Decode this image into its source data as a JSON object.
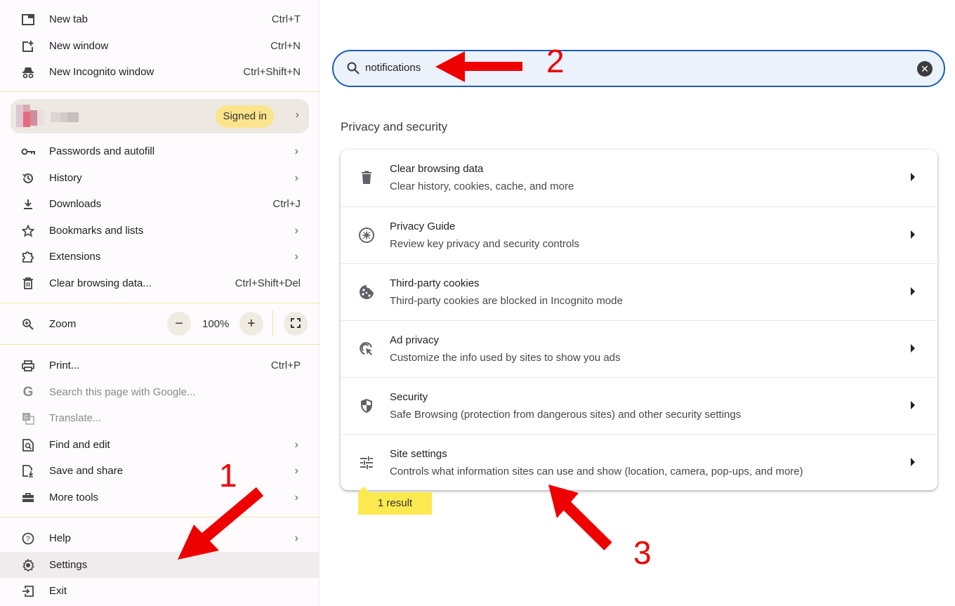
{
  "menu": {
    "items_top": [
      {
        "icon": "new-tab-icon",
        "label": "New tab",
        "shortcut": "Ctrl+T"
      },
      {
        "icon": "new-window-icon",
        "label": "New window",
        "shortcut": "Ctrl+N"
      },
      {
        "icon": "incognito-icon",
        "label": "New Incognito window",
        "shortcut": "Ctrl+Shift+N"
      }
    ],
    "profile": {
      "badge": "Signed in"
    },
    "items_mid": [
      {
        "icon": "key-icon",
        "label": "Passwords and autofill",
        "shortcut": "",
        "submenu": true
      },
      {
        "icon": "history-icon",
        "label": "History",
        "shortcut": "",
        "submenu": true
      },
      {
        "icon": "download-icon",
        "label": "Downloads",
        "shortcut": "Ctrl+J",
        "submenu": false
      },
      {
        "icon": "star-icon",
        "label": "Bookmarks and lists",
        "shortcut": "",
        "submenu": true
      },
      {
        "icon": "extension-icon",
        "label": "Extensions",
        "shortcut": "",
        "submenu": true
      },
      {
        "icon": "trash-icon",
        "label": "Clear browsing data...",
        "shortcut": "Ctrl+Shift+Del",
        "submenu": false
      }
    ],
    "zoom": {
      "label": "Zoom",
      "value": "100%",
      "minus": "−",
      "plus": "+"
    },
    "items_tools": [
      {
        "icon": "print-icon",
        "label": "Print...",
        "shortcut": "Ctrl+P",
        "submenu": false,
        "disabled": false
      },
      {
        "icon": "google-icon",
        "label": "Search this page with Google...",
        "shortcut": "",
        "submenu": false,
        "disabled": true
      },
      {
        "icon": "translate-icon",
        "label": "Translate...",
        "shortcut": "",
        "submenu": false,
        "disabled": true
      },
      {
        "icon": "find-icon",
        "label": "Find and edit",
        "shortcut": "",
        "submenu": true,
        "disabled": false
      },
      {
        "icon": "save-share-icon",
        "label": "Save and share",
        "shortcut": "",
        "submenu": true,
        "disabled": false
      },
      {
        "icon": "toolbox-icon",
        "label": "More tools",
        "shortcut": "",
        "submenu": true,
        "disabled": false
      }
    ],
    "items_bottom": [
      {
        "icon": "help-icon",
        "label": "Help",
        "submenu": true
      },
      {
        "icon": "gear-icon",
        "label": "Settings",
        "submenu": false,
        "active": true
      },
      {
        "icon": "exit-icon",
        "label": "Exit",
        "submenu": false
      }
    ]
  },
  "settings": {
    "search": {
      "value": "notifications"
    },
    "section_title": "Privacy and security",
    "rows": [
      {
        "icon": "trash-icon",
        "title": "Clear browsing data",
        "subtitle": "Clear history, cookies, cache, and more"
      },
      {
        "icon": "compass-icon",
        "title": "Privacy Guide",
        "subtitle": "Review key privacy and security controls"
      },
      {
        "icon": "cookie-icon",
        "title": "Third-party cookies",
        "subtitle": "Third-party cookies are blocked in Incognito mode"
      },
      {
        "icon": "ad-privacy-icon",
        "title": "Ad privacy",
        "subtitle": "Customize the info used by sites to show you ads"
      },
      {
        "icon": "shield-icon",
        "title": "Security",
        "subtitle": "Safe Browsing (protection from dangerous sites) and other security settings"
      },
      {
        "icon": "tune-icon",
        "title": "Site settings",
        "subtitle": "Controls what information sites can use and show (location, camera, pop-ups, and more)"
      }
    ],
    "result_badge": "1 result"
  },
  "annotations": {
    "step1": "1",
    "step2": "2",
    "step3": "3",
    "color": "#ee0000"
  }
}
